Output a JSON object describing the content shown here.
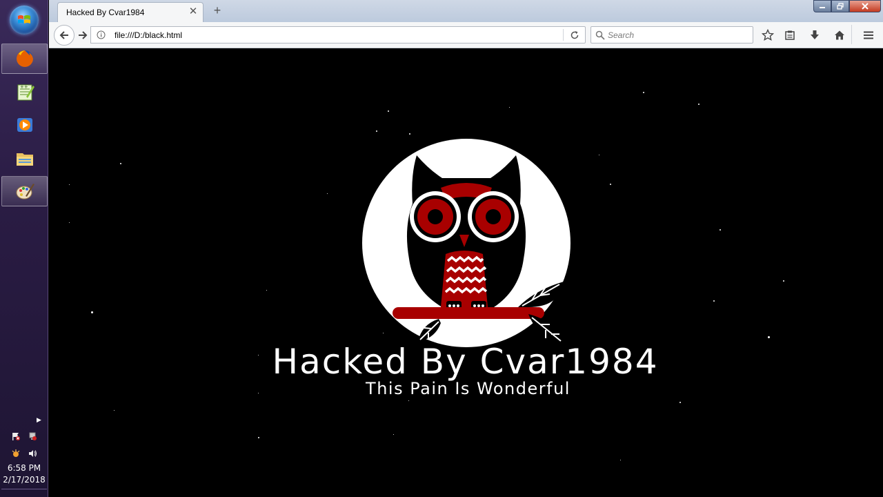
{
  "taskbar": {
    "apps": [
      {
        "name": "Firefox",
        "icon": "firefox-icon",
        "active": true
      },
      {
        "name": "Notepad++",
        "icon": "notepad-plus-icon",
        "active": false
      },
      {
        "name": "Media Player",
        "icon": "media-player-icon",
        "active": false
      },
      {
        "name": "Windows Explorer",
        "icon": "folder-icon",
        "active": false
      },
      {
        "name": "Paint",
        "icon": "paint-icon",
        "active": true
      }
    ],
    "clock": {
      "time": "6:58 PM",
      "date": "2/17/2018"
    }
  },
  "browser": {
    "tab": {
      "title": "Hacked By Cvar1984"
    },
    "new_tab_label": "+",
    "url": "file:///D:/black.html",
    "search": {
      "placeholder": "Search",
      "value": ""
    }
  },
  "page": {
    "headline": "Hacked By Cvar1984",
    "subline": "This Pain Is Wonderful"
  },
  "colors": {
    "page_background": "#000000",
    "accent_red": "#a80000",
    "text": "#ffffff"
  }
}
